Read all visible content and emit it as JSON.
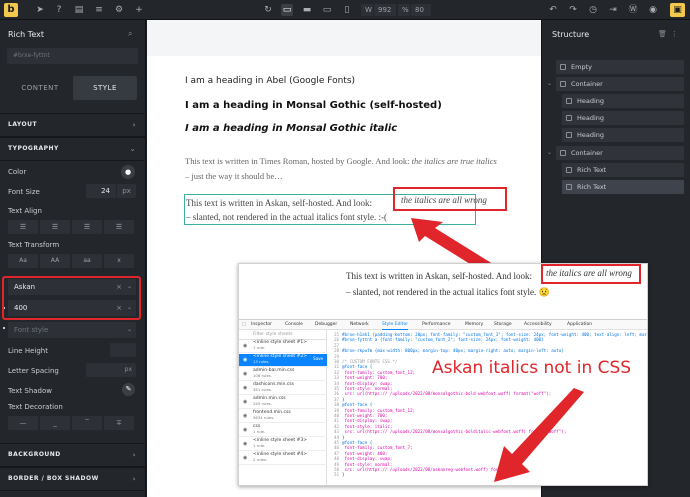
{
  "toolbar": {
    "logo": "b",
    "width_label": "W",
    "width_value": "992",
    "zoom_label": "%",
    "zoom_value": "80"
  },
  "left_panel": {
    "title": "Rich Text",
    "element_id": "#brxe-fyttnt",
    "tabs": [
      "CONTENT",
      "STYLE"
    ],
    "sections": {
      "layout": "LAYOUT",
      "typography": "TYPOGRAPHY",
      "background": "BACKGROUND",
      "border": "BORDER / BOX SHADOW"
    },
    "color_label": "Color",
    "font_size_label": "Font Size",
    "font_size_value": "24",
    "font_size_unit": "px",
    "text_align_label": "Text Align",
    "text_transform_label": "Text Transform",
    "text_transform_options": [
      "Aa",
      "AA",
      "aa",
      "x"
    ],
    "font_family": "Askan",
    "font_weight": "400",
    "font_style_placeholder": "Font style",
    "line_height_label": "Line Height",
    "letter_spacing_label": "Letter Spacing",
    "letter_spacing_unit": "px",
    "text_shadow_label": "Text Shadow",
    "text_decoration_label": "Text Decoration"
  },
  "canvas": {
    "heading_abel": "I am a heading in Abel (Google Fonts)",
    "heading_monsal": "I am a heading in Monsal Gothic (self-hosted)",
    "heading_monsal_italic": "I am a heading in Monsal Gothic italic",
    "times_text_1": "This text is written in Times Roman, hosted by Google. And look: ",
    "times_italic": "the italics are true italics",
    "times_text_2": " – just the way it should be…",
    "askan_text_1": "This text is written in Askan, self-hosted. And look: ",
    "askan_italic": "the italics are all wrong",
    "askan_text_2": "– slanted, not rendered in the actual italics font style. :-("
  },
  "structure": {
    "title": "Structure",
    "items": [
      {
        "label": "Empty"
      },
      {
        "label": "Container"
      },
      {
        "label": "Heading"
      },
      {
        "label": "Heading"
      },
      {
        "label": "Heading"
      },
      {
        "label": "Container"
      },
      {
        "label": "Rich Text"
      },
      {
        "label": "Rich Text"
      }
    ]
  },
  "screenshot": {
    "text_1": "This text is written in Askan, self-hosted. And look: ",
    "italic": "the italics are all wrong",
    "text_2": "– slanted, not rendered in the actual italics font style. 😟",
    "devtools_tabs": [
      "Inspector",
      "Console",
      "Debugger",
      "Network",
      "Style Editor",
      "Performance",
      "Memory",
      "Storage",
      "Accessibility",
      "Application"
    ],
    "filter_placeholder": "Filter style sheets",
    "sheets": [
      {
        "name": "<inline style sheet #1>",
        "rules": "1 rule."
      },
      {
        "name": "<inline style sheet #2>",
        "rules": "13 rules.",
        "save": "Save"
      },
      {
        "name": "admin-bar.min.css",
        "rules": "106 rules."
      },
      {
        "name": "dashicons.min.css",
        "rules": "351 rules."
      },
      {
        "name": "admin.min.css",
        "rules": "245 rules."
      },
      {
        "name": "frontend.min.css",
        "rules": "3634 rules."
      },
      {
        "name": "css",
        "rules": "1 rule."
      },
      {
        "name": "<inline style sheet #3>",
        "rules": "1 rule."
      },
      {
        "name": "<inline style sheet #4>",
        "rules": "2 rules."
      }
    ],
    "code": [
      {
        "n": "25",
        "t": "#brxe-h1ah1 {padding-bottom: 20px; font-family: \"custom_font_3\"; font-size: 24px; font-weight: 400; text-align: left; margin-top: 20px}"
      },
      {
        "n": "26",
        "t": "#brxe-fyttnt a {font-family: \"custom_font_2\"; font-size: 24px; font-weight: 400}"
      },
      {
        "n": "27",
        "t": ""
      },
      {
        "n": "28",
        "t": "#brxe-rkpufm {max-width: 800px; margin-top: 40px; margin-right: auto; margin-left: auto}"
      },
      {
        "n": "29",
        "t": ""
      },
      {
        "n": "30",
        "t": "/* CUSTOM FONTS CSS */"
      },
      {
        "n": "31",
        "t": "@font-face {"
      },
      {
        "n": "32",
        "t": "  font-family: custom_font_12;"
      },
      {
        "n": "33",
        "t": "  font-weight: 700;"
      },
      {
        "n": "34",
        "t": "  font-display: swap;"
      },
      {
        "n": "35",
        "t": "  font-style: normal;"
      },
      {
        "n": "36",
        "t": "  src: url(https://                         /uploads/2022/08/monsalgothic-bold-webfont.woff) format(\"woff\");"
      },
      {
        "n": "37",
        "t": "}"
      },
      {
        "n": "38",
        "t": "@font-face {"
      },
      {
        "n": "39",
        "t": "  font-family: custom_font_12;"
      },
      {
        "n": "40",
        "t": "  font-weight: 700;"
      },
      {
        "n": "41",
        "t": "  font-display: swap;"
      },
      {
        "n": "42",
        "t": "  font-style: italic;"
      },
      {
        "n": "43",
        "t": "  src: url(https://                         /uploads/2022/08/monsalgothic-bolditalic-webfont.woff) format(\"woff\");"
      },
      {
        "n": "44",
        "t": "}"
      },
      {
        "n": "45",
        "t": "@font-face {"
      },
      {
        "n": "46",
        "t": "  font-family: custom_font_7;"
      },
      {
        "n": "47",
        "t": "  font-weight: 400;"
      },
      {
        "n": "48",
        "t": "  font-display: swap;"
      },
      {
        "n": "49",
        "t": "  font-style: normal;"
      },
      {
        "n": "50",
        "t": "  src: url(https://                         /uploads/2022/08/askanreg-webfont.woff) format(\"woff\");"
      },
      {
        "n": "51",
        "t": "}"
      }
    ],
    "annotation": "Askan italics not in CSS"
  },
  "colors": {
    "accent": "#f2c94c",
    "annotation_red": "#e0262b",
    "selection_teal": "#3bb0a0",
    "devtools_blue": "#0a84ff"
  }
}
